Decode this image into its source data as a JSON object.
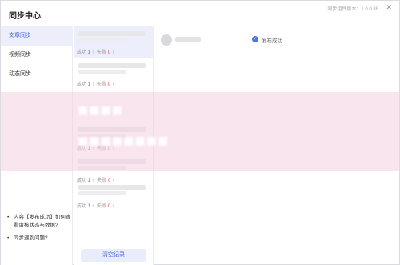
{
  "window": {
    "title": "同步中心",
    "version": "同步组件版本：1.0.0.88"
  },
  "sidebar": {
    "items": [
      {
        "label": "文章同步"
      },
      {
        "label": "视频同步"
      },
      {
        "label": "动态同步"
      }
    ],
    "help": [
      {
        "label": "内容【发布成功】如何查看审核状态与数据?"
      },
      {
        "label": "同步遇到问题?"
      }
    ]
  },
  "list": {
    "cards": [
      {
        "success_label": "成功",
        "success": "1",
        "fail_label": "失败",
        "fail": "0"
      },
      {
        "success_label": "成功",
        "success": "1",
        "fail_label": "失败",
        "fail": "0"
      },
      {
        "success_label": "成功",
        "success": "1",
        "fail_label": "失败",
        "fail": "0"
      },
      {
        "success_label": "成功",
        "success": "1",
        "fail_label": "失败",
        "fail": "0"
      },
      {
        "success_label": "成功",
        "success": "1",
        "fail_label": "失败",
        "fail": "0"
      }
    ],
    "clear_label": "清空记录"
  },
  "detail": {
    "status": "发布成功"
  },
  "colors": {
    "accent": "#4a62d8",
    "fail": "#e74c3c",
    "overlay": "#f4d0e0"
  }
}
